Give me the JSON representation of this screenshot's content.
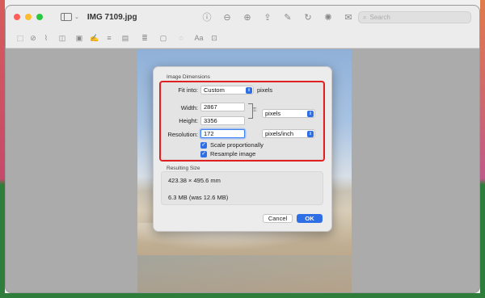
{
  "window": {
    "title": "IMG 7109.jpg"
  },
  "search": {
    "placeholder": "Search"
  },
  "dialog": {
    "image_dimensions_label": "Image Dimensions",
    "fit_into_label": "Fit into:",
    "fit_into_value": "Custom",
    "fit_into_unit": "pixels",
    "width_label": "Width:",
    "width_value": "2867",
    "height_label": "Height:",
    "height_value": "3356",
    "size_unit": "pixels",
    "resolution_label": "Resolution:",
    "resolution_value": "172",
    "resolution_unit": "pixels/inch",
    "scale_proportionally": "Scale proportionally",
    "resample_image": "Resample image",
    "resulting_size_label": "Resulting Size",
    "dimensions_result": "423.38 × 495.6 mm",
    "size_result": "6.3 MB (was 12.6 MB)",
    "cancel_label": "Cancel",
    "ok_label": "OK"
  },
  "colors": {
    "accent": "#2f6fe6",
    "highlight": "#e02020"
  }
}
